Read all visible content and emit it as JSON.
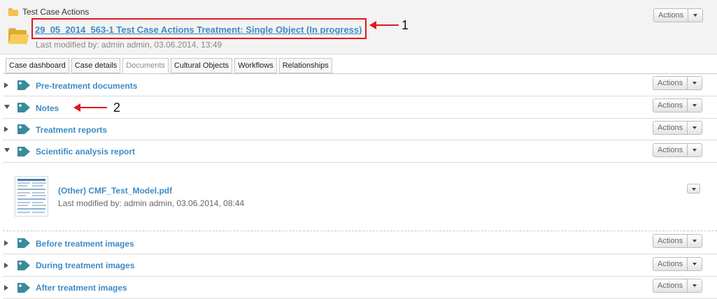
{
  "breadcrumb": "Test Case Actions",
  "case": {
    "title": "29_05_2014_563-1 Test Case Actions Treatment: Single Object (In progress)",
    "modified": "Last modified by: admin admin, 03.06.2014, 13:49",
    "actions_label": "Actions"
  },
  "tabs": [
    {
      "label": "Case dashboard",
      "active": false
    },
    {
      "label": "Case details",
      "active": false
    },
    {
      "label": "Documents",
      "active": true
    },
    {
      "label": "Cultural Objects",
      "active": false
    },
    {
      "label": "Workflows",
      "active": false
    },
    {
      "label": "Relationships",
      "active": false
    }
  ],
  "sections": [
    {
      "label": "Pre-treatment documents",
      "expanded": false,
      "actions_label": "Actions"
    },
    {
      "label": "Notes",
      "expanded": true,
      "actions_label": "Actions"
    },
    {
      "label": "Treatment reports",
      "expanded": false,
      "actions_label": "Actions"
    },
    {
      "label": "Scientific analysis report",
      "expanded": true,
      "actions_label": "Actions"
    },
    {
      "label": "Before treatment images",
      "expanded": false,
      "actions_label": "Actions"
    },
    {
      "label": "During treatment images",
      "expanded": false,
      "actions_label": "Actions"
    },
    {
      "label": "After treatment images",
      "expanded": false,
      "actions_label": "Actions"
    }
  ],
  "document": {
    "name": "(Other) CMF_Test_Model.pdf",
    "modified": "Last modified by: admin admin, 03.06.2014, 08:44"
  },
  "annotations": [
    "1",
    "2"
  ],
  "colors": {
    "link": "#3d8bc6",
    "annotation": "#e0161f",
    "tag_icon": "#3a8a9c"
  },
  "icons": [
    "folder-icon",
    "tag-icon",
    "expand-arrow-icon",
    "collapse-arrow-icon",
    "dropdown-caret-icon",
    "pdf-thumbnail"
  ]
}
